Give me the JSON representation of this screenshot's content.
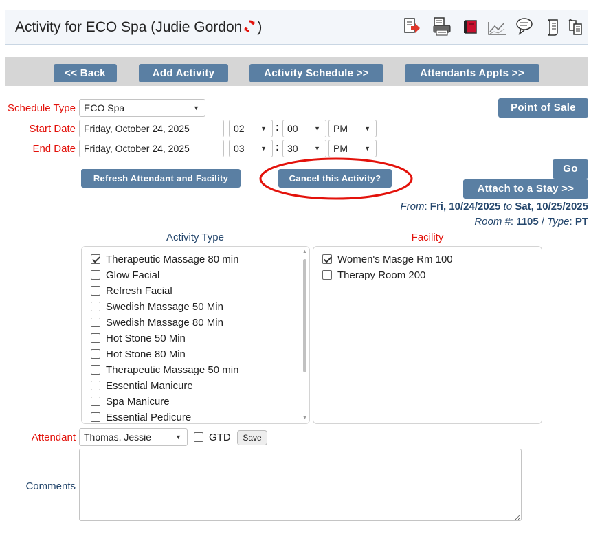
{
  "header": {
    "title_prefix": "Activity for ECO Spa (Judie Gordon",
    "title_suffix": ")",
    "icons": [
      "export-icon",
      "print-icon",
      "book-icon",
      "chart-icon",
      "comment-icon",
      "scroll-icon",
      "copy-icon"
    ]
  },
  "toolbar": {
    "back": "<< Back",
    "add_activity": "Add Activity",
    "activity_schedule": "Activity Schedule >>",
    "attendants_appts": "Attendants Appts >>"
  },
  "form": {
    "schedule_type_label": "Schedule Type",
    "schedule_type_value": "ECO Spa",
    "start_date_label": "Start Date",
    "start_date_value": "Friday, October 24, 2025",
    "start_hour": "02",
    "start_minute": "00",
    "start_ampm": "PM",
    "end_date_label": "End Date",
    "end_date_value": "Friday, October 24, 2025",
    "end_hour": "03",
    "end_minute": "30",
    "end_ampm": "PM",
    "colon": ":"
  },
  "buttons": {
    "point_of_sale": "Point of Sale",
    "go": "Go",
    "refresh": "Refresh Attendant and Facility",
    "cancel": "Cancel this Activity?",
    "attach": "Attach to a Stay >>",
    "save": "Save"
  },
  "stay": {
    "from_label": "From",
    "from_value": "Fri, 10/24/2025",
    "to_label": "to",
    "to_value": "Sat, 10/25/2025",
    "room_label": "Room #",
    "room_value": "1105",
    "type_label": "Type",
    "type_value": "PT"
  },
  "activity_type": {
    "heading": "Activity Type",
    "items": [
      {
        "label": "Therapeutic Massage 80 min",
        "checked": true
      },
      {
        "label": "Glow Facial",
        "checked": false
      },
      {
        "label": "Refresh Facial",
        "checked": false
      },
      {
        "label": "Swedish Massage 50 Min",
        "checked": false
      },
      {
        "label": "Swedish Massage 80 Min",
        "checked": false
      },
      {
        "label": "Hot Stone 50 Min",
        "checked": false
      },
      {
        "label": "Hot Stone 80 Min",
        "checked": false
      },
      {
        "label": "Therapeutic Massage 50 min",
        "checked": false
      },
      {
        "label": "Essential Manicure",
        "checked": false
      },
      {
        "label": "Spa Manicure",
        "checked": false
      },
      {
        "label": "Essential Pedicure",
        "checked": false
      }
    ]
  },
  "facility": {
    "heading": "Facility",
    "items": [
      {
        "label": "Women's Masge Rm 100",
        "checked": true
      },
      {
        "label": "Therapy Room 200",
        "checked": false
      }
    ]
  },
  "attendant": {
    "label": "Attendant",
    "value": "Thomas, Jessie",
    "gtd_label": "GTD",
    "gtd_checked": false
  },
  "comments": {
    "label": "Comments",
    "value": ""
  },
  "colors": {
    "button": "#5a7fa3",
    "label_red": "#e3120b",
    "navy": "#25476d",
    "annotation_circle": "#e3120b"
  }
}
